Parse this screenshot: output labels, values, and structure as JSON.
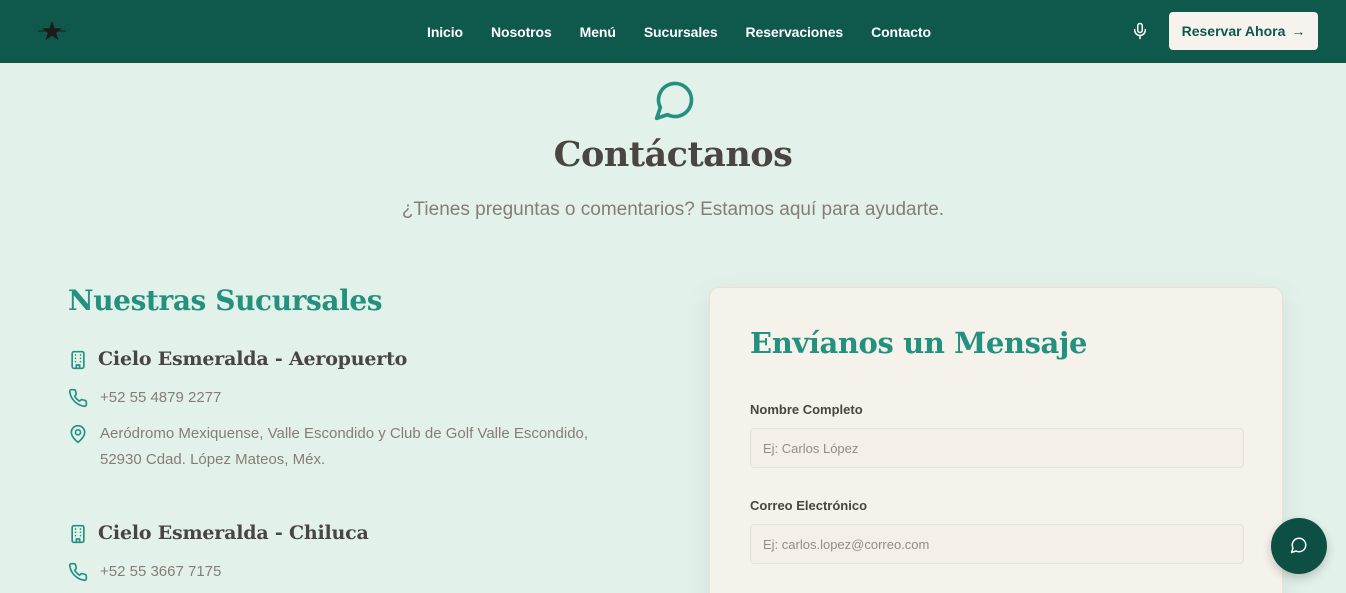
{
  "colors": {
    "nav_bg": "#0e584c",
    "accent": "#23917e",
    "page_bg": "#e2f2ea",
    "card_bg": "#f5f2ec",
    "text": "#4a4540",
    "muted": "#857d76"
  },
  "nav": {
    "links": [
      "Inicio",
      "Nosotros",
      "Menú",
      "Sucursales",
      "Reservaciones",
      "Contacto"
    ],
    "cta_label": "Reservar Ahora",
    "cta_arrow": "→",
    "mic_icon": "microphone-icon",
    "logo_icon": "star-logo-icon"
  },
  "hero": {
    "icon": "chat-bubble-icon",
    "title": "Contáctanos",
    "subtitle": "¿Tienes preguntas o comentarios? Estamos aquí para ayudarte."
  },
  "branches": {
    "title": "Nuestras Sucursales",
    "items": [
      {
        "name": "Cielo Esmeralda - Aeropuerto",
        "phone": "+52 55 4879 2277",
        "address_line1": "Aeródromo Mexiquense, Valle Escondido y Club de Golf Valle Escondido,",
        "address_line2": "52930 Cdad. López Mateos, Méx."
      },
      {
        "name": "Cielo Esmeralda - Chiluca",
        "phone": "+52 55 3667 7175"
      }
    ]
  },
  "form": {
    "title": "Envíanos un Mensaje",
    "name_label": "Nombre Completo",
    "name_placeholder": "Ej: Carlos López",
    "name_value": "",
    "email_label": "Correo Electrónico",
    "email_placeholder": "Ej: carlos.lopez@correo.com",
    "email_value": ""
  },
  "chat_button_icon": "chat-icon"
}
